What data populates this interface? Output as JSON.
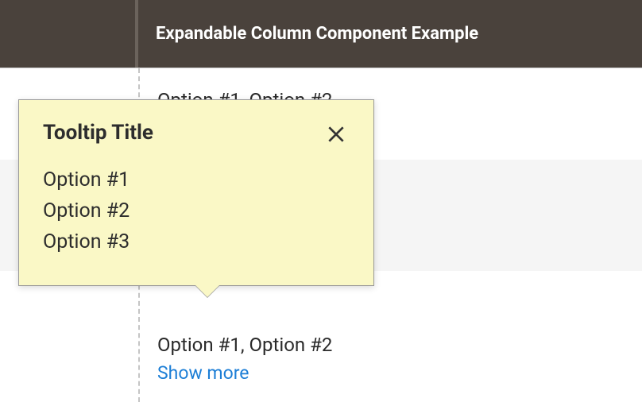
{
  "header": {
    "title": "Expandable Column Component Example"
  },
  "rows": [
    {
      "text": "Option #1, Option #2"
    },
    {
      "text": "Option #1, Option #2"
    }
  ],
  "showMore": "Show more",
  "tooltip": {
    "title": "Tooltip Title",
    "items": [
      "Option #1",
      "Option #2",
      "Option #3"
    ]
  }
}
